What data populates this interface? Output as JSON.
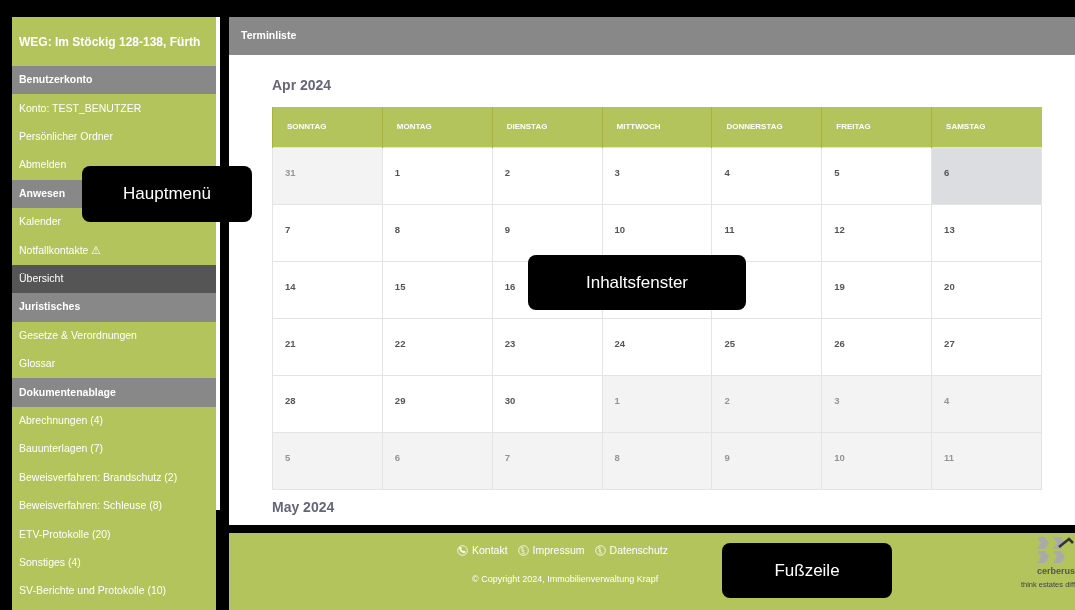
{
  "sidebar": {
    "title": "WEG: Im Stöckig 128-138, Fürth",
    "items": [
      {
        "kind": "heading",
        "label": "Benutzerkonto",
        "selected": false
      },
      {
        "kind": "link",
        "label": "Konto: TEST_BENUTZER",
        "selected": false
      },
      {
        "kind": "link",
        "label": "Persönlicher Ordner",
        "selected": false
      },
      {
        "kind": "link",
        "label": "Abmelden",
        "selected": false
      },
      {
        "kind": "heading",
        "label": "Anwesen",
        "selected": false
      },
      {
        "kind": "link",
        "label": "Kalender",
        "selected": false
      },
      {
        "kind": "link",
        "label": "Notfallkontakte ⚠",
        "selected": false
      },
      {
        "kind": "link",
        "label": "Übersicht",
        "selected": true
      },
      {
        "kind": "heading",
        "label": "Juristisches",
        "selected": false
      },
      {
        "kind": "link",
        "label": "Gesetze & Verordnungen",
        "selected": false
      },
      {
        "kind": "link",
        "label": "Glossar",
        "selected": false
      },
      {
        "kind": "heading",
        "label": "Dokumentenablage",
        "selected": false
      },
      {
        "kind": "link",
        "label": "Abrechnungen (4)",
        "selected": false
      },
      {
        "kind": "link",
        "label": "Bauunterlagen (7)",
        "selected": false
      },
      {
        "kind": "link",
        "label": "Beweisverfahren: Brandschutz (2)",
        "selected": false
      },
      {
        "kind": "link",
        "label": "Beweisverfahren: Schleuse (8)",
        "selected": false
      },
      {
        "kind": "link",
        "label": "ETV-Protokolle (20)",
        "selected": false
      },
      {
        "kind": "link",
        "label": "Sonstiges (4)",
        "selected": false
      },
      {
        "kind": "link",
        "label": "SV-Berichte und Protokolle (10)",
        "selected": false
      }
    ]
  },
  "content": {
    "title": "Terminliste",
    "months": [
      {
        "title": "Apr 2024",
        "weekdays": [
          "SONNTAG",
          "MONTAG",
          "DIENSTAG",
          "MITTWOCH",
          "DONNERSTAG",
          "FREITAG",
          "SAMSTAG"
        ],
        "weeks": [
          [
            {
              "day": "31",
              "other_month": true,
              "highlighted": false
            },
            {
              "day": "1",
              "other_month": false,
              "highlighted": false
            },
            {
              "day": "2",
              "other_month": false,
              "highlighted": false
            },
            {
              "day": "3",
              "other_month": false,
              "highlighted": false
            },
            {
              "day": "4",
              "other_month": false,
              "highlighted": false
            },
            {
              "day": "5",
              "other_month": false,
              "highlighted": false
            },
            {
              "day": "6",
              "other_month": false,
              "highlighted": true
            }
          ],
          [
            {
              "day": "7",
              "other_month": false,
              "highlighted": false
            },
            {
              "day": "8",
              "other_month": false,
              "highlighted": false
            },
            {
              "day": "9",
              "other_month": false,
              "highlighted": false
            },
            {
              "day": "10",
              "other_month": false,
              "highlighted": false
            },
            {
              "day": "11",
              "other_month": false,
              "highlighted": false
            },
            {
              "day": "12",
              "other_month": false,
              "highlighted": false
            },
            {
              "day": "13",
              "other_month": false,
              "highlighted": false
            }
          ],
          [
            {
              "day": "14",
              "other_month": false,
              "highlighted": false
            },
            {
              "day": "15",
              "other_month": false,
              "highlighted": false
            },
            {
              "day": "16",
              "other_month": false,
              "highlighted": false
            },
            {
              "other_month": false,
              "highlighted": false
            },
            {
              "other_month": false,
              "highlighted": false
            },
            {
              "day": "19",
              "other_month": false,
              "highlighted": false
            },
            {
              "day": "20",
              "other_month": false,
              "highlighted": false
            }
          ],
          [
            {
              "day": "21",
              "other_month": false,
              "highlighted": false
            },
            {
              "day": "22",
              "other_month": false,
              "highlighted": false
            },
            {
              "day": "23",
              "other_month": false,
              "highlighted": false
            },
            {
              "day": "24",
              "other_month": false,
              "highlighted": false
            },
            {
              "day": "25",
              "other_month": false,
              "highlighted": false
            },
            {
              "day": "26",
              "other_month": false,
              "highlighted": false
            },
            {
              "day": "27",
              "other_month": false,
              "highlighted": false
            }
          ],
          [
            {
              "day": "28",
              "other_month": false,
              "highlighted": false
            },
            {
              "day": "29",
              "other_month": false,
              "highlighted": false
            },
            {
              "day": "30",
              "other_month": false,
              "highlighted": false
            },
            {
              "day": "1",
              "other_month": true,
              "highlighted": false
            },
            {
              "day": "2",
              "other_month": true,
              "highlighted": false
            },
            {
              "day": "3",
              "other_month": true,
              "highlighted": false
            },
            {
              "day": "4",
              "other_month": true,
              "highlighted": false
            }
          ],
          [
            {
              "day": "5",
              "other_month": true,
              "highlighted": false
            },
            {
              "day": "6",
              "other_month": true,
              "highlighted": false
            },
            {
              "day": "7",
              "other_month": true,
              "highlighted": false
            },
            {
              "day": "8",
              "other_month": true,
              "highlighted": false
            },
            {
              "day": "9",
              "other_month": true,
              "highlighted": false
            },
            {
              "day": "10",
              "other_month": true,
              "highlighted": false
            },
            {
              "day": "11",
              "other_month": true,
              "highlighted": false
            }
          ]
        ]
      },
      {
        "title": "May 2024"
      }
    ]
  },
  "footer": {
    "links": [
      {
        "kind": "phone",
        "label": "Kontakt"
      },
      {
        "kind": "paragraph",
        "label": "Impressum"
      },
      {
        "kind": "paragraph",
        "label": "Datenschutz"
      }
    ],
    "copyright": "© Copyright 2024, Immobilienverwaltung Krapf",
    "logo": {
      "name": "cerberus",
      "slogan": "think estates diff"
    }
  },
  "callouts": [
    {
      "kind": "menu",
      "text": "Hauptmenü"
    },
    {
      "kind": "content",
      "text": "Inhaltsfenster"
    },
    {
      "kind": "footer",
      "text": "Fußzeile"
    }
  ]
}
